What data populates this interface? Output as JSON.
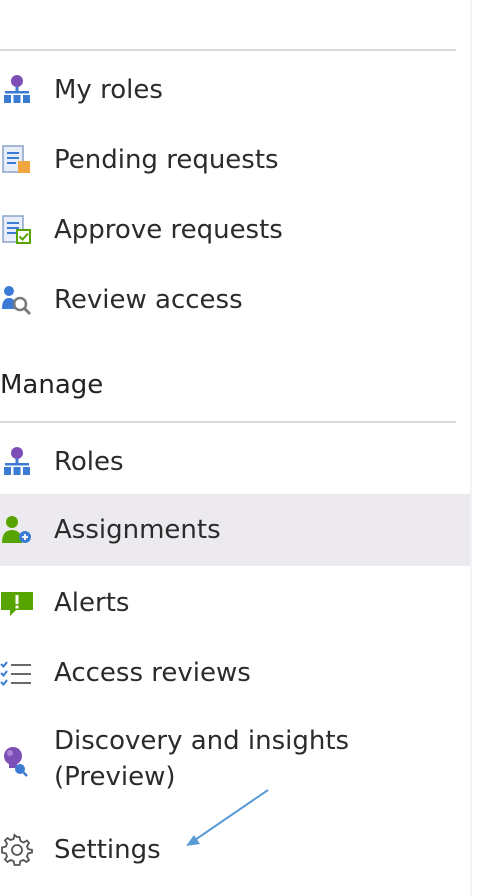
{
  "nav": {
    "top_items": [
      {
        "label": "My roles",
        "icon": "roles-hierarchy-icon"
      },
      {
        "label": "Pending requests",
        "icon": "pending-requests-icon"
      },
      {
        "label": "Approve requests",
        "icon": "approve-requests-icon"
      },
      {
        "label": "Review access",
        "icon": "review-access-icon"
      }
    ],
    "manage": {
      "title": "Manage",
      "items": [
        {
          "label": "Roles",
          "icon": "roles-hierarchy-icon"
        },
        {
          "label": "Assignments",
          "icon": "assignments-icon",
          "selected": true
        },
        {
          "label": "Alerts",
          "icon": "alert-icon"
        },
        {
          "label": "Access reviews",
          "icon": "checklist-icon"
        },
        {
          "label": "Discovery and insights (Preview)",
          "icon": "discovery-bulb-icon"
        },
        {
          "label": "Settings",
          "icon": "gear-icon"
        }
      ]
    }
  },
  "colors": {
    "selected_background": "#eceaee",
    "arrow": "#5b9bd5",
    "divider": "#d9d9d9"
  }
}
